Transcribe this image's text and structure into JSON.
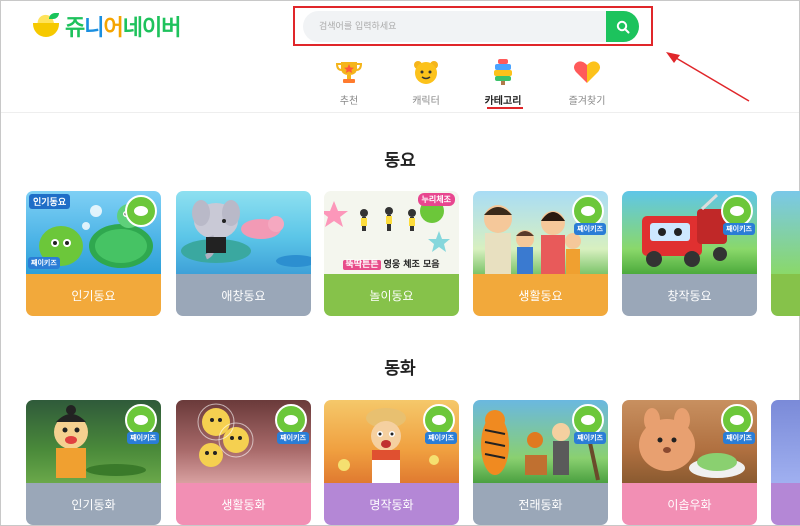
{
  "header": {
    "logo_text": [
      "쥬",
      "니",
      "어",
      "네이버"
    ],
    "search_placeholder": "검색어를 입력하세요"
  },
  "nav": [
    {
      "label": "추천",
      "icon": "trophy-icon"
    },
    {
      "label": "캐릭터",
      "icon": "character-face-icon"
    },
    {
      "label": "카테고리",
      "icon": "category-stack-icon",
      "active": true
    },
    {
      "label": "즐겨찾기",
      "icon": "heart-icon"
    }
  ],
  "sections": [
    {
      "title": "동요",
      "cards": [
        {
          "label": "인기동요",
          "color": "#f2a93b",
          "tag": "인기동요",
          "badge": "째이키즈"
        },
        {
          "label": "애창동요",
          "color": "#9aa7b8"
        },
        {
          "label": "놀이동요",
          "color": "#86c24a",
          "tag_right": "누리체조",
          "banner_hl": "뚝딱튼튼",
          "banner": "영웅 체조 모음"
        },
        {
          "label": "생활동요",
          "color": "#f2a93b",
          "badge": "째이키즈"
        },
        {
          "label": "창작동요",
          "color": "#9aa7b8",
          "badge": "째이키즈"
        }
      ]
    },
    {
      "title": "동화",
      "cards": [
        {
          "label": "인기동화",
          "color": "#9aa7b8",
          "badge": "째이키즈"
        },
        {
          "label": "생활동화",
          "color": "#f28fb4",
          "badge": "째이키즈"
        },
        {
          "label": "명작동화",
          "color": "#b487d6",
          "badge": "째이키즈"
        },
        {
          "label": "전래동화",
          "color": "#9aa7b8",
          "badge": "째이키즈"
        },
        {
          "label": "이솝우화",
          "color": "#f28fb4",
          "badge": "째이키즈"
        }
      ]
    }
  ],
  "colors": {
    "brand_green": "#1cc35d",
    "highlight_red": "#e0262a"
  }
}
